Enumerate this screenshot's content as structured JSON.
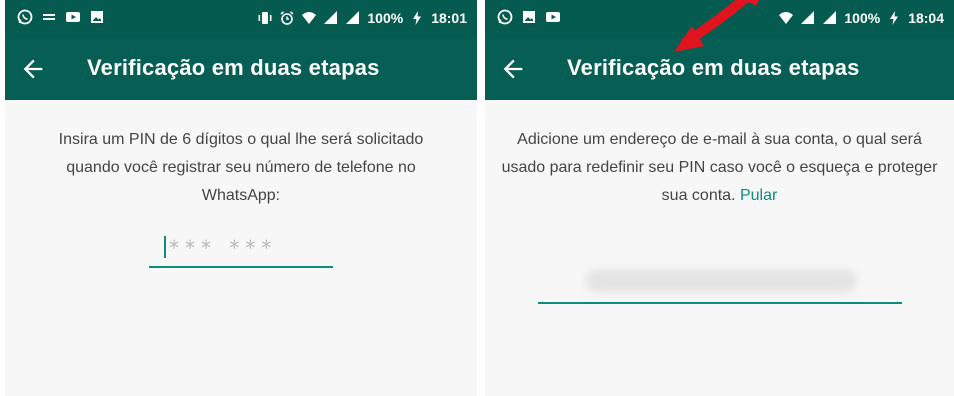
{
  "left_screen": {
    "status": {
      "battery": "100%",
      "time": "18:01"
    },
    "app_bar": {
      "title": "Verificação em duas etapas",
      "back_icon": "arrow-left-icon"
    },
    "content": {
      "instruction": "Insira um PIN de 6 dígitos o qual lhe será solicitado quando você registrar seu número de telefone no WhatsApp:",
      "pin_placeholder": "*** ***"
    }
  },
  "right_screen": {
    "status": {
      "battery": "100%",
      "time": "18:04"
    },
    "app_bar": {
      "title": "Verificação em duas etapas",
      "back_icon": "arrow-left-icon"
    },
    "content": {
      "instruction": "Adicione um endereço de e-mail à sua conta, o qual será usado para redefinir seu PIN caso você o esqueça e proteger sua conta.",
      "skip_link": "Pular"
    }
  },
  "colors": {
    "status_bar": "#055b50",
    "app_bar": "#075e54",
    "accent": "#0a8f7b",
    "background": "#f7f7f7",
    "annotation_arrow": "#e0141e"
  }
}
